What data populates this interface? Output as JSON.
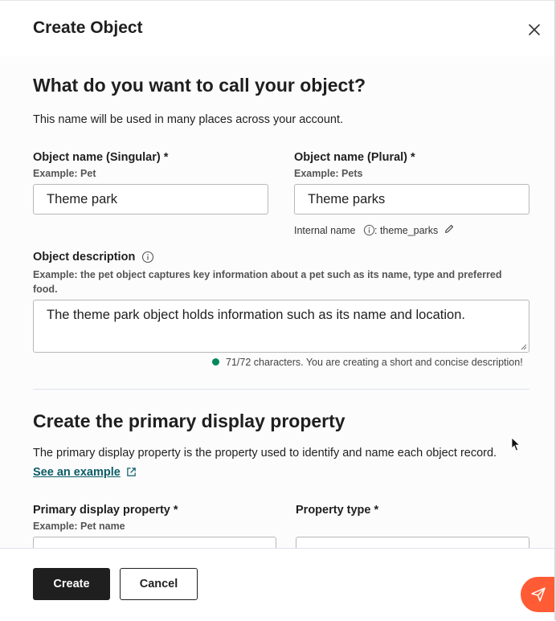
{
  "modal": {
    "title": "Create Object"
  },
  "naming": {
    "heading": "What do you want to call your object?",
    "description": "This name will be used in many places across your account.",
    "singular": {
      "label": "Object name (Singular) *",
      "hint": "Example: Pet",
      "value": "Theme park"
    },
    "plural": {
      "label": "Object name (Plural) *",
      "hint": "Example: Pets",
      "value": "Theme parks"
    },
    "internal_name": {
      "label": "Internal name",
      "value": ": theme_parks"
    },
    "object_description": {
      "label": "Object description",
      "hint": "Example: the pet object captures key information about a pet such as its name, type and preferred food.",
      "value": "The theme park object holds information such as its name and location.",
      "status": "71/72 characters. You are creating a short and concise description!",
      "status_color": "#00875a"
    }
  },
  "display_property": {
    "heading": "Create the primary display property",
    "description": "The primary display property is the property used to identify and name each object record.",
    "example_link": "See an example",
    "primary": {
      "label": "Primary display property *",
      "hint": "Example: Pet name"
    },
    "type": {
      "label": "Property type *"
    }
  },
  "footer": {
    "create_label": "Create",
    "cancel_label": "Cancel"
  },
  "colors": {
    "primary_button": "#1f1f1f",
    "link": "#0a5c67",
    "fab": "#ff5c35",
    "success_dot": "#00875a"
  },
  "icons": {
    "close": "close-icon",
    "info": "info-icon",
    "edit": "pencil-icon",
    "external": "external-link-icon",
    "send": "send-icon"
  }
}
